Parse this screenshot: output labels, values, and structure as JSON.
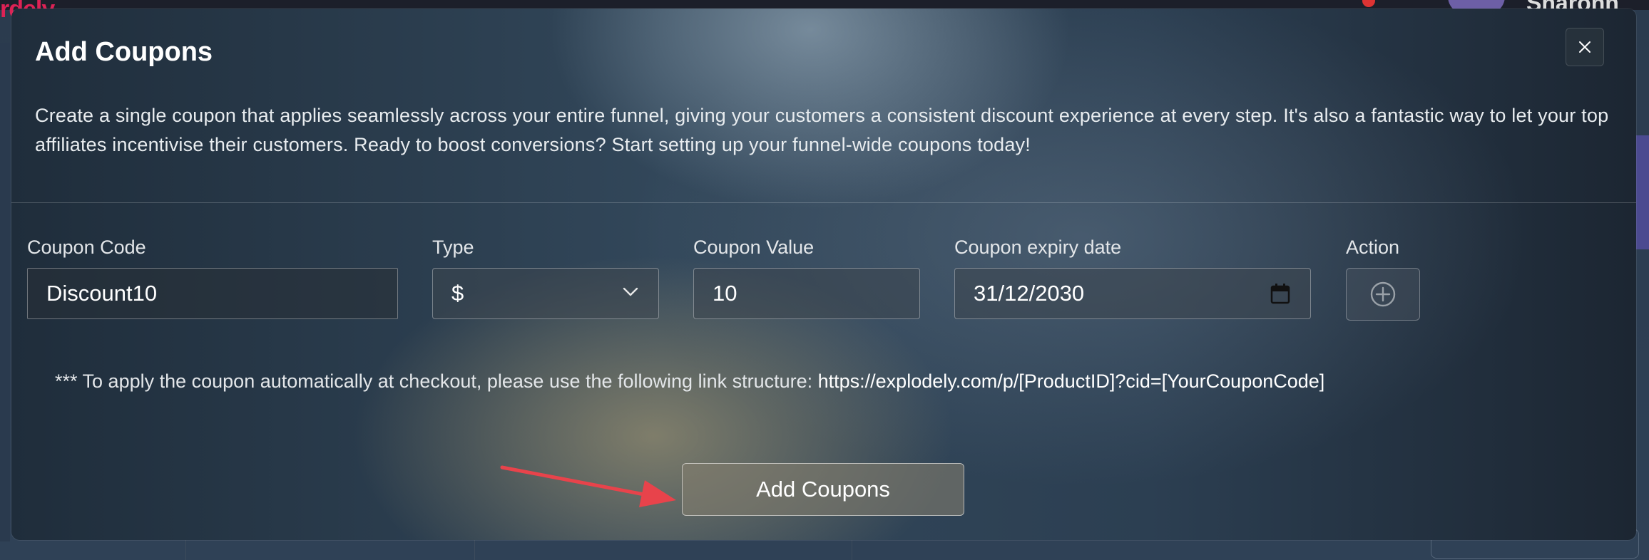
{
  "background": {
    "logo_text": "rdely",
    "user_name": "Sharonn Su"
  },
  "modal": {
    "title": "Add Coupons",
    "description": "Create a single coupon that applies seamlessly across your entire funnel, giving your customers a consistent discount experience at every step. It's also a fantastic way to let your top affiliates incentivise their customers. Ready to boost conversions? Start setting up your funnel-wide coupons today!",
    "close_icon": "close-icon",
    "form": {
      "coupon_code_label": "Coupon Code",
      "coupon_code_value": "Discount10",
      "type_label": "Type",
      "type_value": "$",
      "coupon_value_label": "Coupon Value",
      "coupon_value_value": "10",
      "expiry_label": "Coupon expiry date",
      "expiry_value": "31/12/2030",
      "action_label": "Action",
      "action_icon": "add-circle-icon"
    },
    "note_prefix": "*** To apply the coupon automatically at checkout, please use the following link structure: ",
    "note_link": "https://explodely.com/p/[ProductID]?cid=[YourCouponCode]",
    "submit_label": "Add Coupons"
  },
  "colors": {
    "annotation_arrow": "#e8434b"
  }
}
